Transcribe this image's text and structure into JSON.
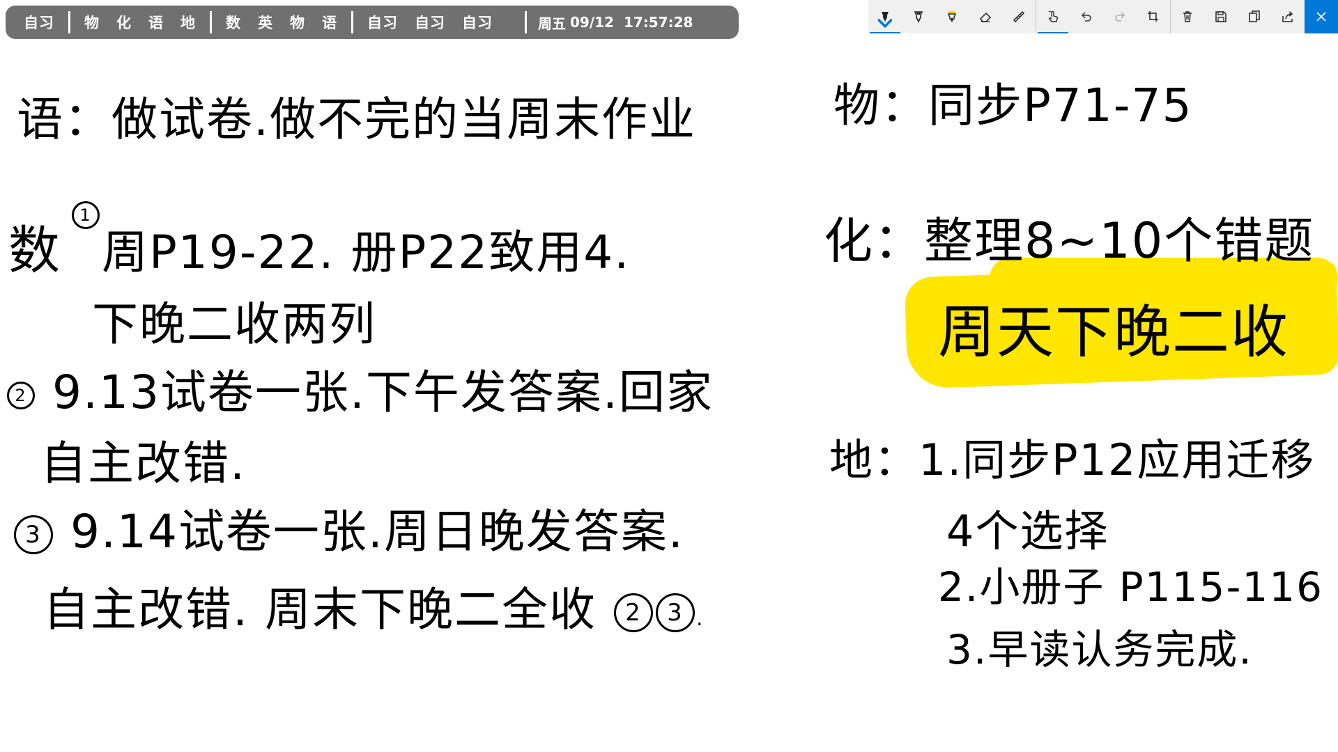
{
  "schedule_bar": {
    "groups": [
      [
        "自习"
      ],
      [
        "物",
        "化",
        "语",
        "地"
      ],
      [
        "数",
        "英",
        "物",
        "语"
      ],
      [
        "自习",
        "自习",
        "自习"
      ]
    ],
    "weekday": "周五",
    "date": "09/12",
    "time": "17:57:28",
    "bar_color": "#707070",
    "text_color": "#ffffff"
  },
  "toolbar": {
    "buttons": [
      {
        "icon": "ballpoint-pen-icon",
        "active": true
      },
      {
        "icon": "pencil-icon",
        "active": false
      },
      {
        "icon": "highlighter-icon",
        "active": false
      },
      {
        "icon": "eraser-icon",
        "active": false
      },
      {
        "icon": "ruler-icon",
        "active": false
      },
      {
        "icon": "touch-writing-icon",
        "active": true
      },
      {
        "icon": "undo-icon",
        "active": false
      },
      {
        "icon": "redo-icon",
        "active": false
      },
      {
        "icon": "crop-icon",
        "active": false
      },
      {
        "icon": "delete-icon",
        "active": false
      },
      {
        "icon": "save-icon",
        "active": false
      },
      {
        "icon": "copy-icon",
        "active": false
      },
      {
        "icon": "share-icon",
        "active": false
      },
      {
        "icon": "close-icon",
        "active": false
      }
    ],
    "accent_color": "#0078d7",
    "background": "#f0f0f0"
  },
  "notes": {
    "chinese": "语：做试卷.做不完的当周末作业",
    "math_line1_prefix": "数",
    "math_line1_circle": "1",
    "math_line1_text": "周P19-22. 册P22致用4.",
    "math_line2": "下晚二收两列",
    "math_line3_circle": "2",
    "math_line3_text": "9.13试卷一张.下午发答案.回家",
    "math_line4": "自主改错.",
    "math_line5_circle": "3",
    "math_line5_text": "9.14试卷一张.周日晚发答案.",
    "math_line6_text": "自主改错. 周末下晚二全收",
    "math_line6_circle_a": "2",
    "math_line6_circle_b": "3",
    "math_line6_end": ".",
    "physics": "物：同步P71-75",
    "chemistry_line1": "化：整理8~10个错题",
    "chemistry_line2": "周天下晚二收",
    "geo_line1": "地：1.同步P12应用迁移",
    "geo_line2": "4个选择",
    "geo_line3": "2.小册子 P115-116",
    "geo_line4": "3.早读认务完成.",
    "highlight_color": "#ffe600",
    "ink_color": "#000000"
  }
}
